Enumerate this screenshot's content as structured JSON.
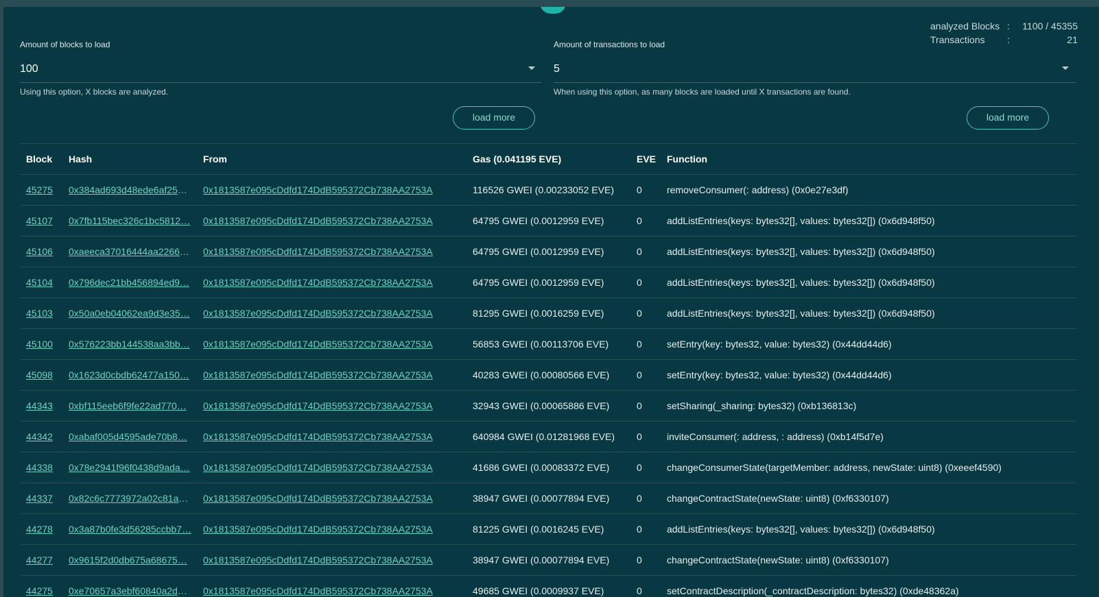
{
  "stats": {
    "analyzed_label": "analyzed Blocks",
    "analyzed_value": "1100 / 45355",
    "tx_label": "Transactions",
    "tx_value": "21",
    "separator": ":"
  },
  "blocks_select": {
    "label": "Amount of blocks to load",
    "value": "100",
    "hint": "Using this option, X blocks are analyzed.",
    "button": "load more"
  },
  "tx_select": {
    "label": "Amount of transactions to load",
    "value": "5",
    "hint": "When using this option, as many blocks are loaded until X transactions are found.",
    "button": "load more"
  },
  "table": {
    "headers": {
      "block": "Block",
      "hash": "Hash",
      "from": "From",
      "gas": "Gas (0.041195 EVE)",
      "eve": "EVE",
      "function": "Function"
    },
    "rows": [
      {
        "block": "45275",
        "hash": "0x384ad693d48ede6af25a…",
        "from": "0x1813587e095cDdfd174DdB595372Cb738AA2753A",
        "gas": "116526 GWEI (0.00233052 EVE)",
        "eve": "0",
        "function": "removeConsumer(: address) (0x0e27e3df)"
      },
      {
        "block": "45107",
        "hash": "0x7fb115bec326c1bc5812…",
        "from": "0x1813587e095cDdfd174DdB595372Cb738AA2753A",
        "gas": "64795 GWEI (0.0012959 EVE)",
        "eve": "0",
        "function": "addListEntries(keys: bytes32[], values: bytes32[]) (0x6d948f50)"
      },
      {
        "block": "45106",
        "hash": "0xaeeca37016444aa22668…",
        "from": "0x1813587e095cDdfd174DdB595372Cb738AA2753A",
        "gas": "64795 GWEI (0.0012959 EVE)",
        "eve": "0",
        "function": "addListEntries(keys: bytes32[], values: bytes32[]) (0x6d948f50)"
      },
      {
        "block": "45104",
        "hash": "0x796dec21bb456894ed9…",
        "from": "0x1813587e095cDdfd174DdB595372Cb738AA2753A",
        "gas": "64795 GWEI (0.0012959 EVE)",
        "eve": "0",
        "function": "addListEntries(keys: bytes32[], values: bytes32[]) (0x6d948f50)"
      },
      {
        "block": "45103",
        "hash": "0x50a0eb04062ea9d3e35…",
        "from": "0x1813587e095cDdfd174DdB595372Cb738AA2753A",
        "gas": "81295 GWEI (0.0016259 EVE)",
        "eve": "0",
        "function": "addListEntries(keys: bytes32[], values: bytes32[]) (0x6d948f50)"
      },
      {
        "block": "45100",
        "hash": "0x576223bb144538aa3bb…",
        "from": "0x1813587e095cDdfd174DdB595372Cb738AA2753A",
        "gas": "56853 GWEI (0.00113706 EVE)",
        "eve": "0",
        "function": "setEntry(key: bytes32, value: bytes32) (0x44dd44d6)"
      },
      {
        "block": "45098",
        "hash": "0x1623d0cbdb62477a150…",
        "from": "0x1813587e095cDdfd174DdB595372Cb738AA2753A",
        "gas": "40283 GWEI (0.00080566 EVE)",
        "eve": "0",
        "function": "setEntry(key: bytes32, value: bytes32) (0x44dd44d6)"
      },
      {
        "block": "44343",
        "hash": "0xbf115eeb6f9fe22ad770…",
        "from": "0x1813587e095cDdfd174DdB595372Cb738AA2753A",
        "gas": "32943 GWEI (0.00065886 EVE)",
        "eve": "0",
        "function": "setSharing(_sharing: bytes32) (0xb136813c)"
      },
      {
        "block": "44342",
        "hash": "0xabaf005d4595ade70b8…",
        "from": "0x1813587e095cDdfd174DdB595372Cb738AA2753A",
        "gas": "640984 GWEI (0.01281968 EVE)",
        "eve": "0",
        "function": "inviteConsumer(: address, : address) (0xb14f5d7e)"
      },
      {
        "block": "44338",
        "hash": "0x78e2941f96f0438d9ada…",
        "from": "0x1813587e095cDdfd174DdB595372Cb738AA2753A",
        "gas": "41686 GWEI (0.00083372 EVE)",
        "eve": "0",
        "function": "changeConsumerState(targetMember: address, newState: uint8) (0xeeef4590)"
      },
      {
        "block": "44337",
        "hash": "0x82c6c7773972a02c81ab…",
        "from": "0x1813587e095cDdfd174DdB595372Cb738AA2753A",
        "gas": "38947 GWEI (0.00077894 EVE)",
        "eve": "0",
        "function": "changeContractState(newState: uint8) (0xf6330107)"
      },
      {
        "block": "44278",
        "hash": "0x3a87b0fe3d56285ccbb7…",
        "from": "0x1813587e095cDdfd174DdB595372Cb738AA2753A",
        "gas": "81225 GWEI (0.0016245 EVE)",
        "eve": "0",
        "function": "addListEntries(keys: bytes32[], values: bytes32[]) (0x6d948f50)"
      },
      {
        "block": "44277",
        "hash": "0x9615f2d0db675a68675…",
        "from": "0x1813587e095cDdfd174DdB595372Cb738AA2753A",
        "gas": "38947 GWEI (0.00077894 EVE)",
        "eve": "0",
        "function": "changeContractState(newState: uint8) (0xf6330107)"
      },
      {
        "block": "44275",
        "hash": "0xe70657a3ebf60840a2d2…",
        "from": "0x1813587e095cDdfd174DdB595372Cb738AA2753A",
        "gas": "49685 GWEI (0.0009937 EVE)",
        "eve": "0",
        "function": "setContractDescription(_contractDescription: bytes32) (0xde48362a)"
      }
    ]
  }
}
